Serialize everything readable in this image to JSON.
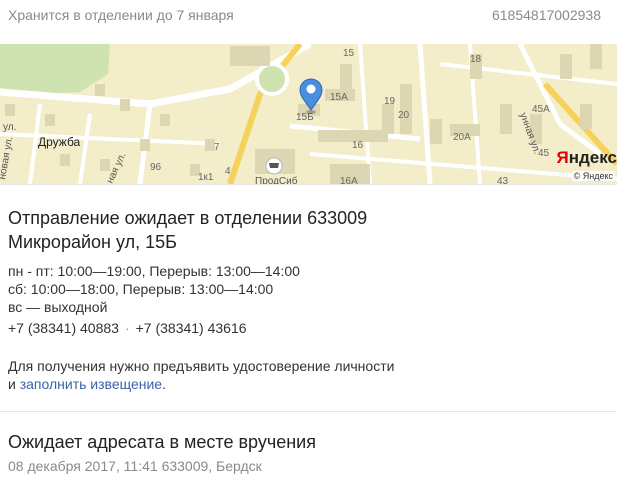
{
  "header": {
    "storage_text": "Хранится в отделении до 7 января",
    "tracking_number": "61854817002938"
  },
  "map": {
    "labels": {
      "druzhba": "Дружба",
      "street_left": "новая ул.",
      "street_left2": "ул.",
      "street_mid": "ная ул.",
      "street_right": "унная ул.",
      "shop": "ПродСиб"
    },
    "building_numbers": [
      "15",
      "15А",
      "15Б",
      "20",
      "19",
      "16",
      "16А",
      "18",
      "20А",
      "45А",
      "45",
      "43",
      "96",
      "1к1",
      "4",
      "7"
    ],
    "brand_red": "Я",
    "brand_rest": "ндекс",
    "copyright": "© Яндекс",
    "colors": {
      "land": "#f3edc9",
      "road": "#ffffff",
      "major_road": "#f7d25a",
      "building": "#ddd6b2",
      "park": "#cfe3b0",
      "pin": "#4a8ee0"
    }
  },
  "office": {
    "title": "Отправление ожидает в отделении 633009",
    "address": "Микрорайон ул, 15Б",
    "hours": [
      "пн - пт: 10:00—19:00, Перерыв: 13:00—14:00",
      "сб: 10:00—18:00, Перерыв: 13:00—14:00",
      "вс — выходной"
    ],
    "phones": [
      "+7 (38341) 40883",
      "+7 (38341) 43616"
    ],
    "note_text": "Для получения нужно предъявить удостоверение личности",
    "note_prefix": "и ",
    "note_link": "заполнить извещение",
    "note_suffix": "."
  },
  "event": {
    "status": "Ожидает адресата в месте вручения",
    "meta": "08 декабря 2017, 11:41 633009, Бердск"
  }
}
